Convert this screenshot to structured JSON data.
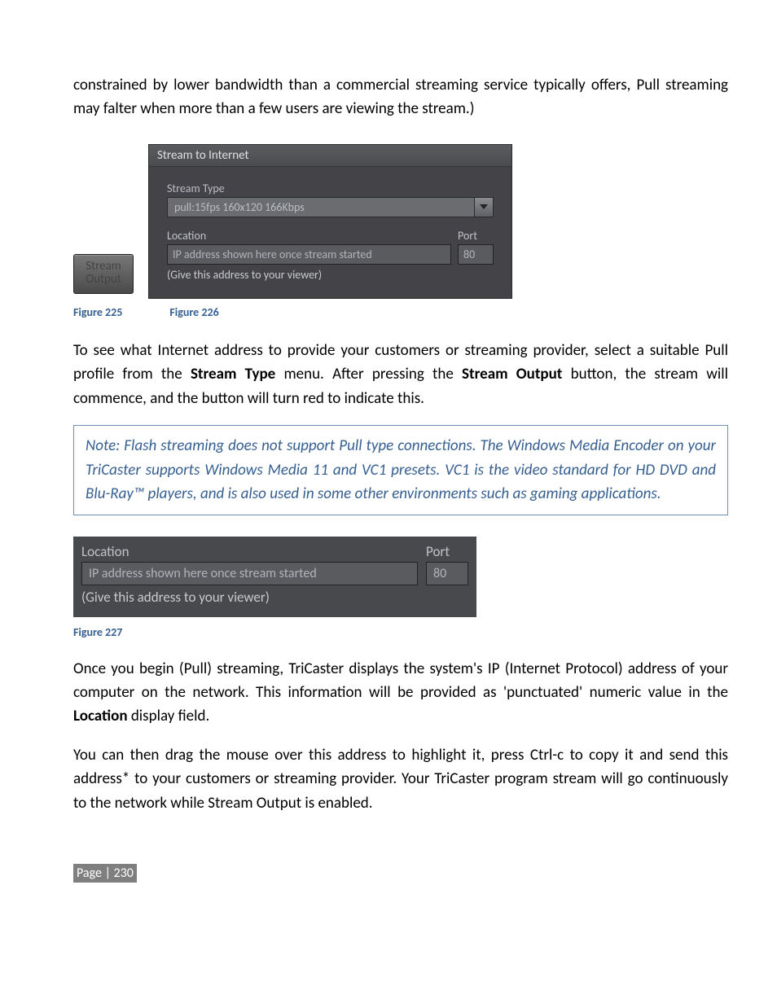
{
  "intro_paragraph": "constrained by lower bandwidth than a commercial streaming service typically offers, Pull streaming may falter when more than a few users are viewing the stream.)",
  "fig225": {
    "button_line1": "Stream",
    "button_line2": "Output",
    "titlebar": "Stream to Internet",
    "stream_type_label": "Stream Type",
    "stream_type_value": "pull:15fps 160x120 166Kbps",
    "location_label": "Location",
    "location_value": "IP address shown here once stream started",
    "location_hint": "(Give this address to your viewer)",
    "port_label": "Port",
    "port_value": "80"
  },
  "caption225": "Figure 225",
  "caption226": "Figure 226",
  "para2_pre": "To see what Internet address to provide your customers or streaming provider, select a suitable Pull profile from the ",
  "para2_bold1": "Stream Type",
  "para2_mid": " menu.  After pressing the ",
  "para2_bold2": "Stream Output",
  "para2_post": " button, the stream will commence, and the button will turn red to indicate this.",
  "note": "Note: Flash streaming does not support Pull type connections. The Windows Media Encoder on your TriCaster supports Windows Media 11 and VC1 presets. VC1 is the video standard for HD DVD and Blu-Ray™ players, and is also used in some other environments such as gaming applications.",
  "fig227": {
    "location_label": "Location",
    "location_value": "IP address shown here once stream started",
    "location_hint": "(Give this address to your viewer)",
    "port_label": "Port",
    "port_value": "80"
  },
  "caption227": "Figure 227",
  "para3_pre": "Once you begin (Pull) streaming, TriCaster displays the system's IP (Internet Protocol) address of your computer on the network. This information will be provided as 'punctuated' numeric value in the ",
  "para3_bold": "Location",
  "para3_post": " display field.",
  "para4": "You can then drag the mouse over this address to highlight it, press Ctrl-c to copy it and send this address* to your customers or streaming provider. Your TriCaster program stream will go continuously to the network while Stream Output is enabled.",
  "footer": "Page | 230"
}
